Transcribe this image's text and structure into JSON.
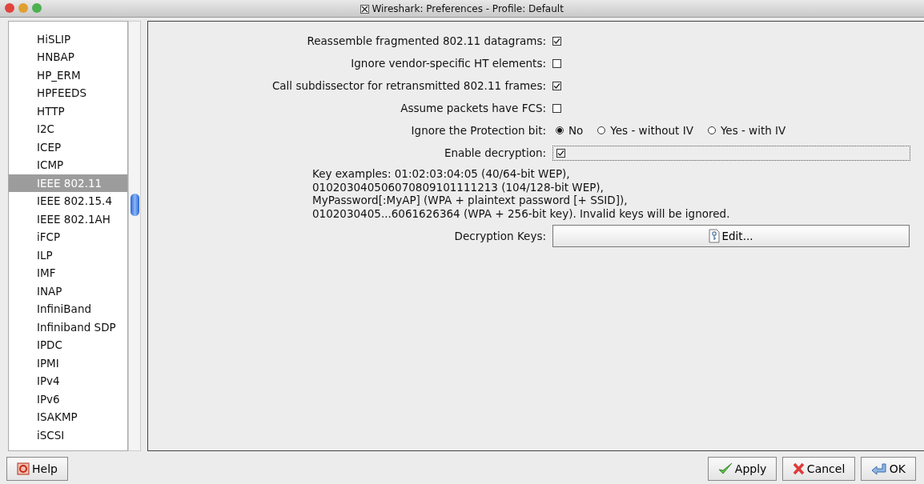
{
  "window": {
    "title": "Wireshark: Preferences - Profile: Default"
  },
  "sidebar": {
    "items": [
      {
        "label": "HiSLIP",
        "selected": false
      },
      {
        "label": "HNBAP",
        "selected": false
      },
      {
        "label": "HP_ERM",
        "selected": false
      },
      {
        "label": "HPFEEDS",
        "selected": false
      },
      {
        "label": "HTTP",
        "selected": false
      },
      {
        "label": "I2C",
        "selected": false
      },
      {
        "label": "ICEP",
        "selected": false
      },
      {
        "label": "ICMP",
        "selected": false
      },
      {
        "label": "IEEE 802.11",
        "selected": true
      },
      {
        "label": "IEEE 802.15.4",
        "selected": false
      },
      {
        "label": "IEEE 802.1AH",
        "selected": false
      },
      {
        "label": "iFCP",
        "selected": false
      },
      {
        "label": "ILP",
        "selected": false
      },
      {
        "label": "IMF",
        "selected": false
      },
      {
        "label": "INAP",
        "selected": false
      },
      {
        "label": "InfiniBand",
        "selected": false
      },
      {
        "label": "Infiniband SDP",
        "selected": false
      },
      {
        "label": "IPDC",
        "selected": false
      },
      {
        "label": "IPMI",
        "selected": false
      },
      {
        "label": "IPv4",
        "selected": false
      },
      {
        "label": "IPv6",
        "selected": false
      },
      {
        "label": "ISAKMP",
        "selected": false
      },
      {
        "label": "iSCSI",
        "selected": false
      }
    ]
  },
  "settings": [
    {
      "kind": "checkbox",
      "label": "Reassemble fragmented 802.11 datagrams:",
      "checked": true
    },
    {
      "kind": "checkbox",
      "label": "Ignore vendor-specific HT elements:",
      "checked": false
    },
    {
      "kind": "checkbox",
      "label": "Call subdissector for retransmitted 802.11 frames:",
      "checked": true
    },
    {
      "kind": "checkbox",
      "label": "Assume packets have FCS:",
      "checked": false
    },
    {
      "kind": "radio",
      "label": "Ignore the Protection bit:",
      "options": [
        {
          "label": "No",
          "selected": true
        },
        {
          "label": "Yes - without IV",
          "selected": false
        },
        {
          "label": "Yes - with IV",
          "selected": false
        }
      ]
    },
    {
      "kind": "checkbox_focused",
      "label": "Enable decryption:",
      "checked": true
    },
    {
      "kind": "note",
      "text": "Key examples: 01:02:03:04:05 (40/64-bit WEP),\n010203040506070809101111213 (104/128-bit WEP),\nMyPassword[:MyAP] (WPA + plaintext password [+ SSID]),\n0102030405...6061626364 (WPA + 256-bit key).  Invalid keys will be ignored."
    },
    {
      "kind": "button",
      "label": "Decryption Keys:",
      "button": "Edit..."
    }
  ],
  "footer": {
    "help": "Help",
    "buttons": [
      {
        "kind": "apply",
        "label": "Apply"
      },
      {
        "kind": "cancel",
        "label": "Cancel"
      },
      {
        "kind": "ok",
        "label": "OK"
      }
    ]
  }
}
